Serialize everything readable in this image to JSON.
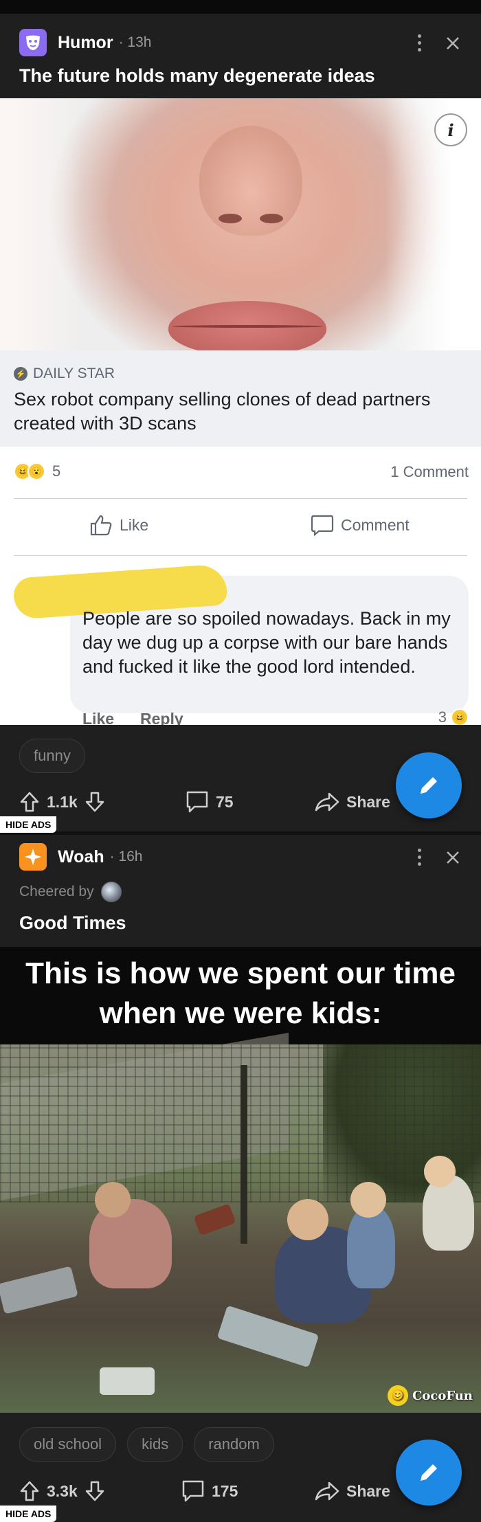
{
  "posts": [
    {
      "community": "Humor",
      "age": "· 13h",
      "title": "The future holds many degenerate ideas",
      "fb": {
        "info_glyph": "i",
        "source": "DAILY STAR",
        "headline": "Sex robot company selling clones of dead partners created with 3D scans",
        "reaction_count": "5",
        "comments_count": "1 Comment",
        "like_label": "Like",
        "comment_label": "Comment",
        "comment_text": "People are so spoiled nowadays. Back in my day we dug up a corpse with our bare hands and fucked it like the good lord intended.",
        "comment_like": "Like",
        "comment_reply": "Reply",
        "comment_react_count": "3"
      },
      "tags": [
        "funny"
      ],
      "upvotes": "1.1k",
      "comments": "75",
      "share_label": "Share"
    },
    {
      "community": "Woah",
      "age": "· 16h",
      "cheered_by": "Cheered by",
      "title": "Good Times",
      "image_caption": "This is how we spent our time when we were kids:",
      "watermark": "CocoFun",
      "tags": [
        "old school",
        "kids",
        "random"
      ],
      "upvotes": "3.3k",
      "comments": "175",
      "share_label": "Share"
    }
  ],
  "hide_ads_label": "HIDE ADS",
  "colors": {
    "background": "#1f1f1f",
    "fab": "#1e88e5",
    "humor_icon": "#8b6cf0",
    "woah_icon": "#f7931e"
  },
  "icons": {
    "humor": "mask-icon",
    "woah": "sparkle-icon",
    "more": "more-vertical-icon",
    "close": "close-icon",
    "upvote": "arrow-up-icon",
    "downvote": "arrow-down-icon",
    "comment": "comment-icon",
    "share": "share-icon",
    "fab": "pencil-icon"
  }
}
